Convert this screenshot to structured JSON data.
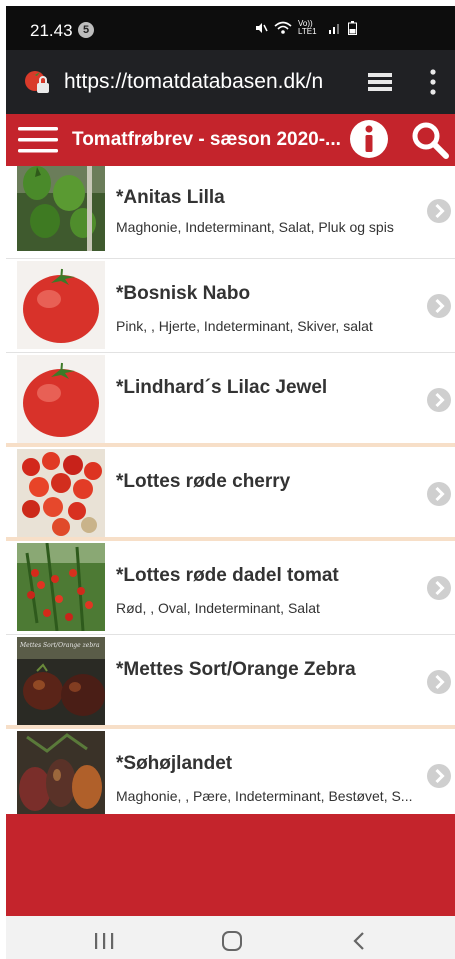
{
  "status": {
    "time": "21.43",
    "badge": "5",
    "icons": [
      "mute-icon",
      "wifi-icon",
      "volte-icon",
      "signal-icon",
      "battery-icon"
    ],
    "volte_text": "Vo)) LTE1"
  },
  "browser": {
    "url": "https://tomatdatabasen.dk/n",
    "icons": [
      "site-tomato-icon",
      "tabs-icon",
      "menu-dots-icon"
    ]
  },
  "header": {
    "title": "Tomatfrøbrev - sæson 2020-...",
    "icons": [
      "hamburger-icon",
      "info-icon",
      "search-icon"
    ]
  },
  "items": [
    {
      "title": "*Anitas Lilla",
      "subtitle": "Maghonie, Indeterminant, Salat, Pluk og spis",
      "image": "green-tomatoes-photo"
    },
    {
      "title": "*Bosnisk Nabo",
      "subtitle": "Pink, , Hjerte, Indeterminant, Skiver, salat",
      "image": "red-tomato-illustration"
    },
    {
      "title": "*Lindhard´s Lilac Jewel",
      "subtitle": "",
      "image": "red-tomato-illustration"
    },
    {
      "title": "*Lottes røde cherry",
      "subtitle": "",
      "image": "cherry-tomatoes-photo"
    },
    {
      "title": "*Lottes røde dadel tomat",
      "subtitle": "Rød, , Oval, Indeterminant, Salat",
      "image": "tomato-plant-photo"
    },
    {
      "title": "*Mettes Sort/Orange Zebra",
      "subtitle": "",
      "image": "zebra-tomatoes-photo",
      "image_caption": "Mettes Sort/Orange zebra"
    },
    {
      "title": "*Søhøjlandet",
      "subtitle": "Maghonie, , Pære, Indeterminant, Bestøvet, S...",
      "image": "pear-tomatoes-photo"
    }
  ],
  "colors": {
    "brand_red": "#c4242c",
    "separator_peach": "#f7dfc8",
    "browser_bar": "#202124",
    "status_bar": "#0d0d0d"
  },
  "nav": {
    "icons": [
      "recents-icon",
      "home-icon",
      "back-icon"
    ]
  }
}
